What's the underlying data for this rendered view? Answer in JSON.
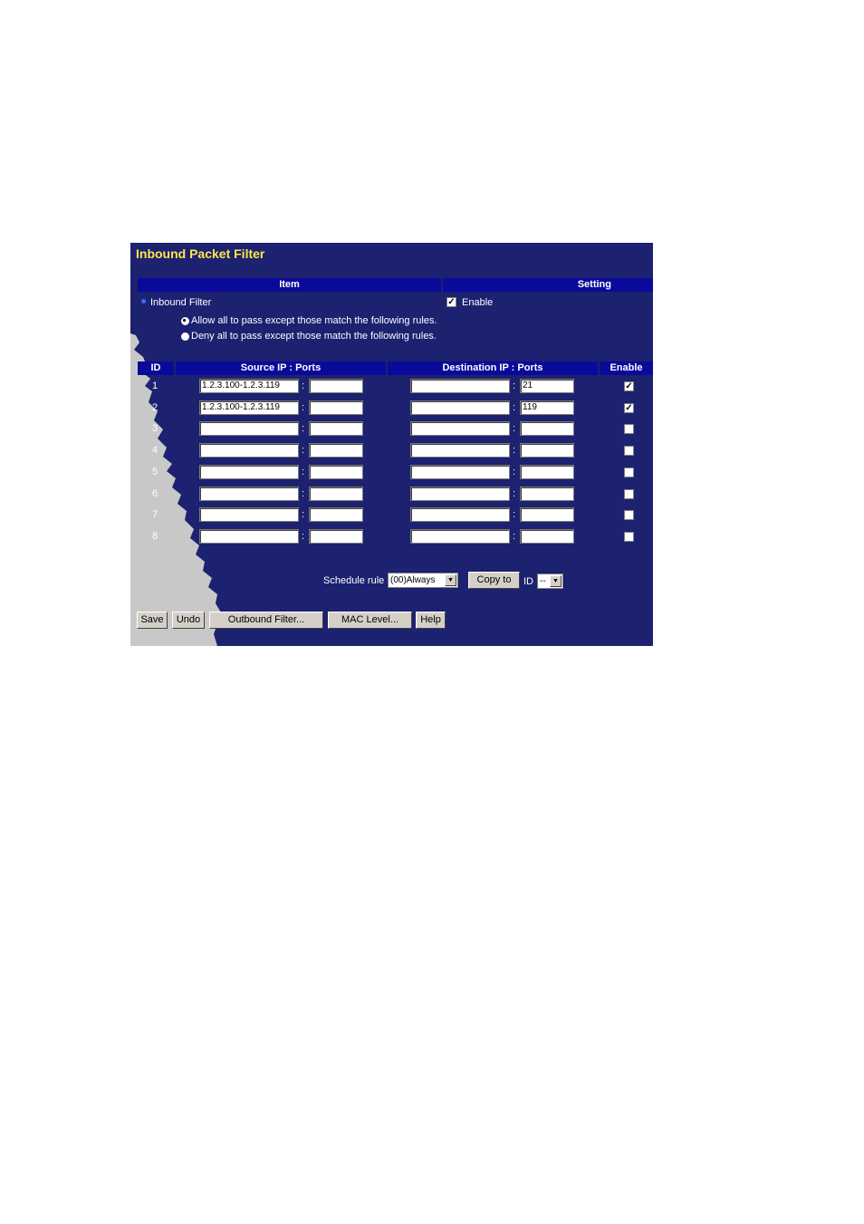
{
  "title": "Inbound Packet Filter",
  "headers": {
    "item": "Item",
    "setting": "Setting"
  },
  "inbound_filter": {
    "label": "Inbound Filter",
    "enable_label": "Enable",
    "enabled": true
  },
  "policy": {
    "allow_label": "Allow all to pass except those match the following rules.",
    "deny_label": "Deny all to pass except those match the following rules.",
    "selected": "allow"
  },
  "table": {
    "columns": {
      "id": "ID",
      "source": "Source IP : Ports",
      "destination": "Destination IP : Ports",
      "enable": "Enable"
    },
    "rows": [
      {
        "id": "1",
        "src_ip": "1.2.3.100-1.2.3.119",
        "src_port": "",
        "dst_ip": "",
        "dst_port": "21",
        "enabled": true
      },
      {
        "id": "2",
        "src_ip": "1.2.3.100-1.2.3.119",
        "src_port": "",
        "dst_ip": "",
        "dst_port": "119",
        "enabled": true
      },
      {
        "id": "3",
        "src_ip": "",
        "src_port": "",
        "dst_ip": "",
        "dst_port": "",
        "enabled": false
      },
      {
        "id": "4",
        "src_ip": "",
        "src_port": "",
        "dst_ip": "",
        "dst_port": "",
        "enabled": false
      },
      {
        "id": "5",
        "src_ip": "",
        "src_port": "",
        "dst_ip": "",
        "dst_port": "",
        "enabled": false
      },
      {
        "id": "6",
        "src_ip": "",
        "src_port": "",
        "dst_ip": "",
        "dst_port": "",
        "enabled": false
      },
      {
        "id": "7",
        "src_ip": "",
        "src_port": "",
        "dst_ip": "",
        "dst_port": "",
        "enabled": false
      },
      {
        "id": "8",
        "src_ip": "",
        "src_port": "",
        "dst_ip": "",
        "dst_port": "",
        "enabled": false
      }
    ]
  },
  "schedule": {
    "label": "Schedule rule",
    "value": "(00)Always",
    "copy_button": "Copy to",
    "id_label": "ID",
    "id_value": "--"
  },
  "buttons": {
    "save": "Save",
    "undo": "Undo",
    "outbound": "Outbound Filter...",
    "mac": "MAC Level...",
    "help": "Help"
  },
  "colors": {
    "background": "#1c2170",
    "header": "#0a0a9a",
    "title": "#ffe74a",
    "map": "#c8c8c8"
  }
}
